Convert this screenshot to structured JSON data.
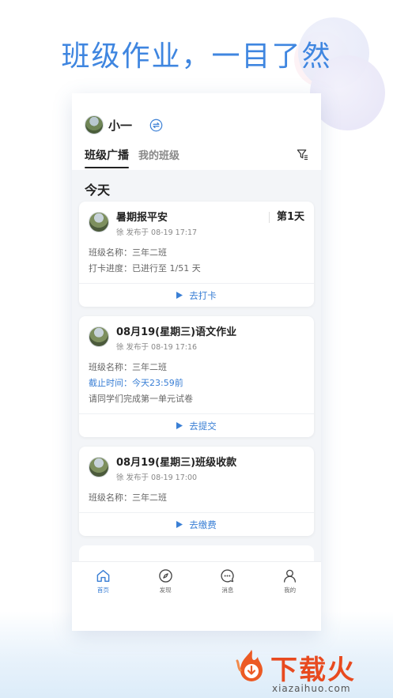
{
  "headline": "班级作业，一目了然",
  "header": {
    "user_name": "小一",
    "tabs": [
      "班级广播",
      "我的班级"
    ]
  },
  "section_title": "今天",
  "cards": [
    {
      "title": "暑期报平安",
      "sub": "徐 发布于 08-19 17:17",
      "badge": "第1天",
      "lines": [
        "班级名称：三年二班",
        "打卡进度：已进行至 1/51 天"
      ],
      "action": "去打卡"
    },
    {
      "title": "08月19(星期三)语文作业",
      "sub": "徐 发布于 08-19 17:16",
      "lines": [
        "班级名称：三年二班",
        "截止时间：今天23:59前",
        "请同学们完成第一单元试卷"
      ],
      "action": "去提交"
    },
    {
      "title": "08月19(星期三)班级收款",
      "sub": "徐 发布于 08-19 17:00",
      "lines": [
        "班级名称：三年二班"
      ],
      "action": "去缴费"
    }
  ],
  "bottom_nav": [
    {
      "label": "首页",
      "icon": "home-icon",
      "active": true
    },
    {
      "label": "发现",
      "icon": "compass-icon"
    },
    {
      "label": "消息",
      "icon": "message-icon"
    },
    {
      "label": "我的",
      "icon": "person-icon"
    }
  ],
  "watermark": {
    "logo_text": "下载火",
    "site": "xiazaihuo.com"
  },
  "colors": {
    "accent": "#3a7fd5",
    "headline": "#3f86e0",
    "logo": "#e84a1f"
  }
}
